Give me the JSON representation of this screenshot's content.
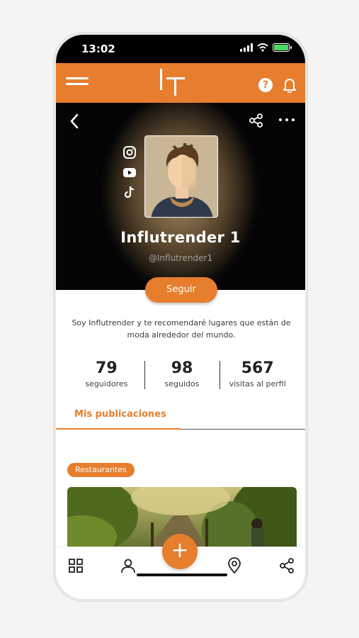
{
  "status_bar": {
    "time": "13:02"
  },
  "profile": {
    "name": "Influtrender 1",
    "handle": "@Influtrender1",
    "follow_label": "Seguir",
    "bio": "Soy Influtrender y te recomendaré lugares que están de moda alrededor del mundo."
  },
  "stats": [
    {
      "value": "79",
      "label": "seguidores"
    },
    {
      "value": "98",
      "label": "seguidos"
    },
    {
      "value": "567",
      "label": "visitas al perfil"
    }
  ],
  "tabs": {
    "publications": "Mis publicaciones"
  },
  "post": {
    "category": "Restaurantes"
  },
  "fab_label": "+",
  "colors": {
    "accent": "#e67e2e",
    "hero_bg": "#050505"
  },
  "icons": [
    "menu-icon",
    "help-icon",
    "bell-icon",
    "back-icon",
    "share-icon",
    "more-icon",
    "instagram-icon",
    "youtube-icon",
    "tiktok-icon",
    "grid-icon",
    "user-icon",
    "location-icon",
    "share-icon"
  ]
}
